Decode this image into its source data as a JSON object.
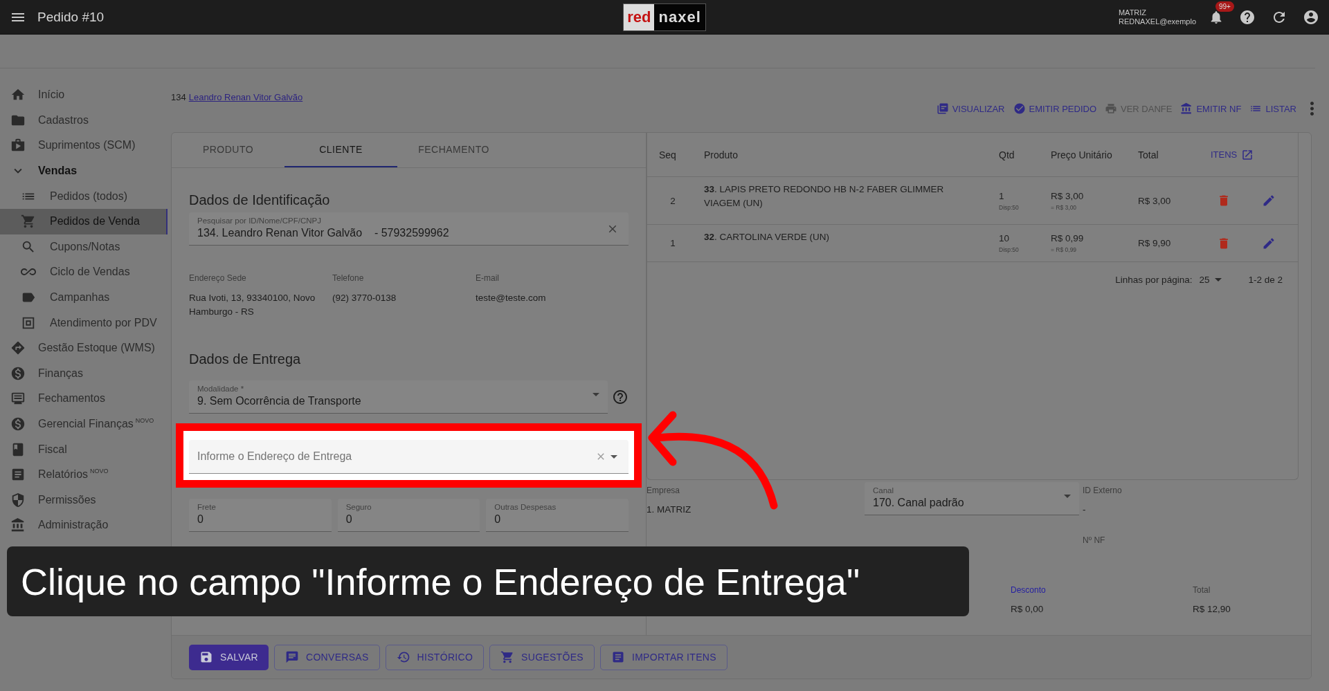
{
  "top_bar": {
    "title": "Pedido #10",
    "logo": [
      "red",
      "naxel"
    ],
    "company": "MATRIZ",
    "user": "REDNAXEL@exemplo",
    "notification_badge": "99+"
  },
  "sidebar": {
    "items": [
      {
        "label": "Início",
        "kind": "link",
        "selected": false
      },
      {
        "label": "Cadastros",
        "kind": "link",
        "selected": false
      },
      {
        "label": "Suprimentos (SCM)",
        "kind": "link",
        "selected": false
      },
      {
        "label": "Vendas",
        "kind": "group",
        "expanded": true,
        "selected": false,
        "children": [
          {
            "label": "Pedidos (todos)",
            "kind": "link",
            "selected": false
          },
          {
            "label": "Pedidos de Venda",
            "kind": "link",
            "selected": true
          },
          {
            "label": "Cupons/Notas",
            "kind": "link",
            "selected": false
          },
          {
            "label": "Ciclo de Vendas",
            "kind": "link",
            "selected": false
          },
          {
            "label": "Campanhas",
            "kind": "link",
            "selected": false
          },
          {
            "label": "Atendimento por PDV",
            "kind": "link",
            "selected": false
          }
        ]
      },
      {
        "label": "Gestão Estoque (WMS)",
        "kind": "link",
        "selected": false
      },
      {
        "label": "Finanças",
        "kind": "link",
        "selected": false
      },
      {
        "label": "Fechamentos",
        "kind": "link",
        "selected": false
      },
      {
        "label": "Gerencial Finanças",
        "badge": "NOVO",
        "kind": "link",
        "selected": false
      },
      {
        "label": "Fiscal",
        "kind": "link",
        "selected": false
      },
      {
        "label": "Relatórios",
        "badge": "NOVO",
        "kind": "link",
        "selected": false
      },
      {
        "label": "Permissões",
        "kind": "link",
        "selected": false
      },
      {
        "label": "Administração",
        "kind": "link",
        "selected": false
      }
    ]
  },
  "customer": {
    "id": "134",
    "name": "Leandro Renan Vitor Galvão"
  },
  "actions": [
    {
      "label": "VISUALIZAR",
      "disabled": false
    },
    {
      "label": "EMITIR PEDIDO",
      "disabled": false
    },
    {
      "label": "VER DANFE",
      "disabled": true
    },
    {
      "label": "EMITIR NF",
      "disabled": false
    },
    {
      "label": "LISTAR",
      "disabled": false
    }
  ],
  "tabs": [
    {
      "label": "PRODUTO",
      "selected": false
    },
    {
      "label": "CLIENTE",
      "selected": true
    },
    {
      "label": "FECHAMENTO",
      "selected": false
    }
  ],
  "identification": {
    "heading": "Dados de Identificação",
    "search": {
      "label": "Pesquisar por ID/Nome/CPF/CNPJ",
      "value": "134. Leandro Renan Vitor Galvão    - 57932599962"
    },
    "info": [
      {
        "label": "Endereço Sede",
        "value": "Rua Ivoti, 13, 93340100, Novo Hamburgo - RS"
      },
      {
        "label": "Telefone",
        "value": "(92) 3770-0138"
      },
      {
        "label": "E-mail",
        "value": "teste@teste.com"
      }
    ]
  },
  "delivery": {
    "heading": "Dados de Entrega",
    "modality": {
      "label": "Modalidade *",
      "value": "9. Sem Ocorrência de Transporte"
    },
    "address": {
      "placeholder": "Informe o Endereço de Entrega",
      "highlighted": true
    },
    "costs": [
      {
        "label": "Frete",
        "value": "0"
      },
      {
        "label": "Seguro",
        "value": "0"
      },
      {
        "label": "Outras Despesas",
        "value": "0"
      }
    ]
  },
  "items_table": {
    "columns": [
      "Seq",
      "Produto",
      "Qtd",
      "Preço Unitário",
      "Total"
    ],
    "items_link": "ITENS",
    "rows": [
      {
        "seq": "2",
        "product": "**33**. LAPIS PRETO REDONDO HB N-2 FABER GLIMMER VIAGEM (UN)",
        "qty": "1",
        "stock": "Disp:50",
        "price": "R$ 3,00",
        "price_note": "= R$ 3,00",
        "total": "R$ 3,00"
      },
      {
        "seq": "1",
        "product": "**32**. CARTOLINA VERDE (UN)",
        "qty": "10",
        "stock": "Disp:50",
        "price": "R$ 0,99",
        "price_note": "= R$ 0,99",
        "total": "R$ 9,90"
      }
    ],
    "pagination": {
      "label": "Linhas por página:",
      "per_page": "25",
      "range": "1-2 de 2"
    }
  },
  "order_info": [
    [
      {
        "label": "Empresa",
        "value": "1. MATRIZ",
        "kind": "text"
      },
      {
        "label": "Canal",
        "value": "170. Canal padrão",
        "kind": "select"
      },
      {
        "label": "ID Externo",
        "value": "-",
        "kind": "text"
      }
    ],
    [
      {
        "label": "Nº NF",
        "kind": "text"
      }
    ],
    [
      {
        "label": "Desconto",
        "value": "R$ 0,00",
        "kind": "link"
      },
      {
        "label": "Total",
        "value": "R$ 12,90",
        "kind": "text"
      }
    ]
  ],
  "buttons": [
    {
      "label": "SALVAR",
      "kind": "primary"
    },
    {
      "label": "CONVERSAS",
      "kind": "outlined"
    },
    {
      "label": "HISTÓRICO",
      "kind": "outlined"
    },
    {
      "label": "SUGESTÕES",
      "kind": "outlined"
    },
    {
      "label": "IMPORTAR ITENS",
      "kind": "outlined"
    }
  ],
  "caption": "Clique no campo \"Informe o Endereço de Entrega\""
}
